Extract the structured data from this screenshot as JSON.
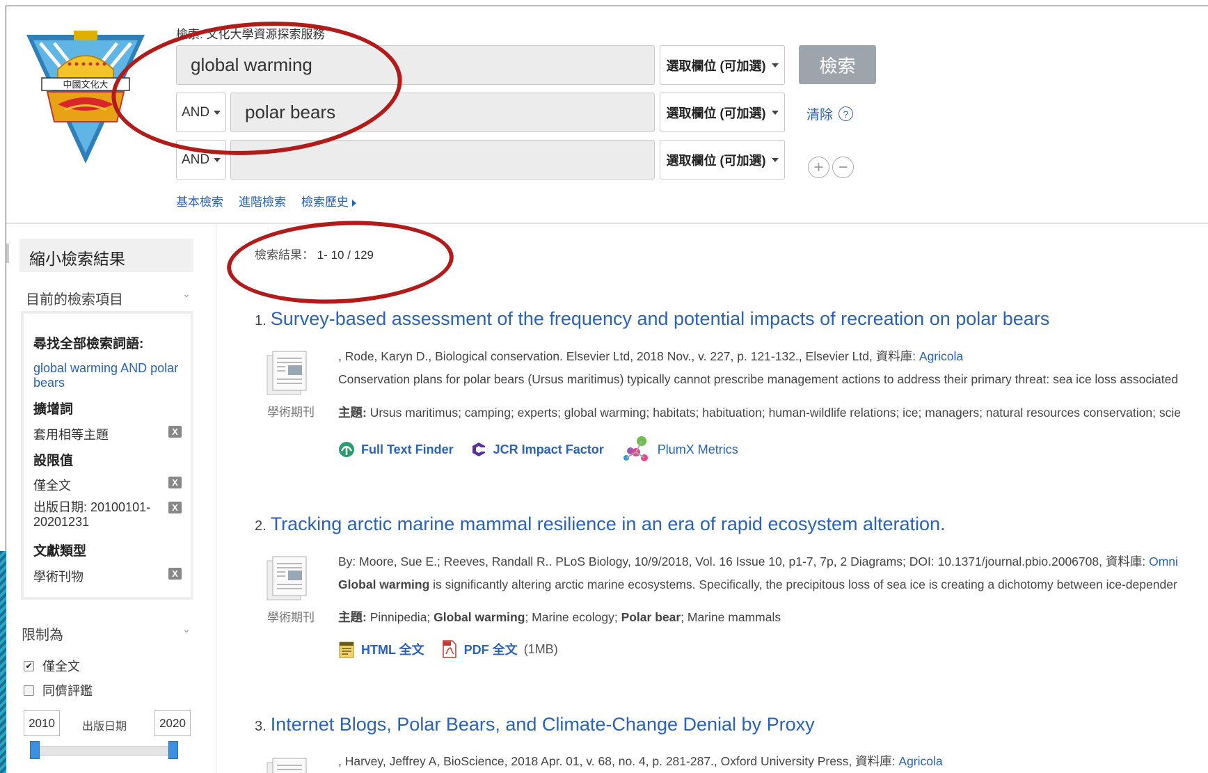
{
  "header": {
    "search_label": "檢索: 文化大學資源探索服務",
    "rows": [
      {
        "bool": "",
        "term": "global warming",
        "field": "選取欄位 (可加選)"
      },
      {
        "bool": "AND",
        "term": "polar bears",
        "field": "選取欄位 (可加選)"
      },
      {
        "bool": "AND",
        "term": "",
        "field": "選取欄位 (可加選)"
      }
    ],
    "search_button": "檢索",
    "clear_link": "清除",
    "help": "?",
    "add_row": "+",
    "remove_row": "−",
    "nav": [
      "基本檢索",
      "進階檢索",
      "檢索歷史"
    ]
  },
  "sidebar": {
    "title": "縮小檢索結果",
    "current_section": "目前的檢索項目",
    "find_all_label": "尋找全部檢索詞語:",
    "query_text": "global warming AND polar bears",
    "expanders_label": "擴增詞",
    "expander_item": "套用相等主題",
    "limiters_label": "設限值",
    "limiter_fulltext": "僅全文",
    "limiter_date": "出版日期: 20100101-20201231",
    "source_type_label": "文獻類型",
    "source_type_item": "學術刊物",
    "remove_icon": "X",
    "limit_to": "限制為",
    "checkbox_fulltext": "僅全文",
    "checkbox_fulltext_checked": true,
    "checkbox_peer": "同儕評鑑",
    "checkbox_peer_checked": false,
    "year_from": "2010",
    "year_to": "2020",
    "date_label": "出版日期"
  },
  "results": {
    "count_label": "檢索結果：",
    "count_value": "1- 10 / 129",
    "items": [
      {
        "index": "1.",
        "title": "Survey-based assessment of the frequency and potential impacts of recreation on polar bears",
        "meta": ", Rode, Karyn D., Biological conservation. Elsevier Ltd, 2018 Nov., v. 227, p. 121-132., Elsevier Ltd, 資料庫: ",
        "db": "Agricola",
        "abstract": "Conservation plans for polar bears (Ursus maritimus) typically cannot prescribe management actions to address their primary threat: sea ice loss associated",
        "subject_label": "主題:",
        "subjects": " Ursus maritimus; camping; experts; global warming; habitats; habituation; human-wildlife relations; ice; managers; natural resources conservation; scie",
        "type": "學術期刊",
        "tools": [
          "Full Text Finder",
          "JCR Impact Factor",
          "PlumX Metrics"
        ]
      },
      {
        "index": "2.",
        "title": "Tracking arctic marine mammal resilience in an era of rapid ecosystem alteration.",
        "meta": "By: Moore, Sue E.; Reeves, Randall R.. PLoS Biology, 10/9/2018, Vol. 16 Issue 10, p1-7, 7p, 2 Diagrams; DOI: 10.1371/journal.pbio.2006708, 資料庫: ",
        "db": "Omni",
        "abstract_bold": "Global warming",
        "abstract": " is significantly altering arctic marine ecosystems. Specifically, the precipitous loss of sea ice is creating a dichotomy between ice-depender",
        "subject_label": "主題:",
        "subjects_a": " Pinnipedia; ",
        "subjects_b": "Global warming",
        "subjects_c": "; Marine ecology; ",
        "subjects_d": "Polar bear",
        "subjects_e": "; Marine mammals",
        "type": "學術期刊",
        "html_label": "HTML 全文",
        "pdf_label": "PDF 全文",
        "pdf_size": "(1MB)"
      },
      {
        "index": "3.",
        "title": "Internet Blogs, Polar Bears, and Climate-Change Denial by Proxy",
        "meta": ", Harvey, Jeffrey A, BioScience, 2018 Apr. 01, v. 68, no. 4, p. 281-287., Oxford University Press, 資料庫: ",
        "db": "Agricola"
      }
    ]
  }
}
